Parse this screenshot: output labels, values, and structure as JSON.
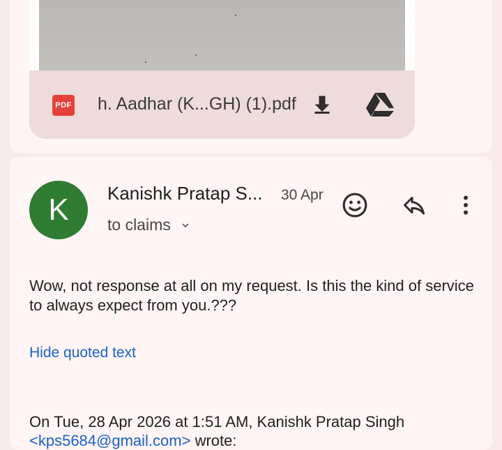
{
  "attachment": {
    "type_badge": "PDF",
    "file_name": "h. Aadhar (K...GH) (1).pdf",
    "download_icon": "download-icon",
    "drive_icon": "google-drive-icon"
  },
  "message": {
    "avatar_letter": "K",
    "avatar_color": "#2e7d32",
    "sender": "Kanishk Pratap S...",
    "date": "30 Apr",
    "to_label": "to claims",
    "body": "Wow, not response at all on my request. Is this the kind of service to always expect from you.???",
    "hide_quoted": "Hide quoted text",
    "quote_header": "On Tue, 28 Apr 2026 at 1:51 AM, Kanishk Pratap Singh",
    "quote_email": "<kps5684@gmail.com>",
    "quote_wrote": " wrote:"
  },
  "colors": {
    "background": "#f9ebeb",
    "card": "#fff5f4",
    "link": "#1a5fd1",
    "pdf_red": "#e5413a"
  }
}
